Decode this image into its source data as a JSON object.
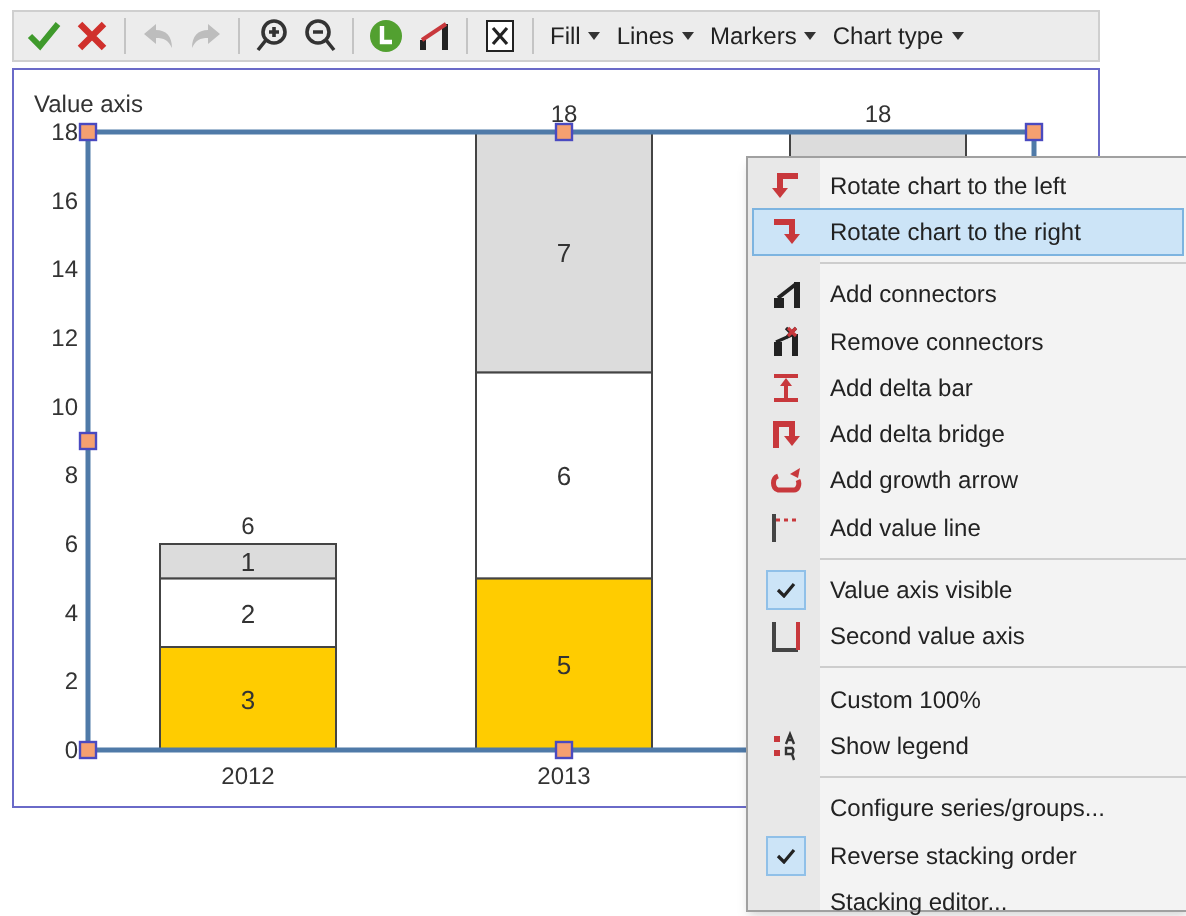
{
  "toolbar": {
    "buttons": [
      {
        "kind": "check",
        "disabled": false
      },
      {
        "kind": "cross",
        "disabled": false
      },
      {
        "kind": "undo",
        "disabled": true
      },
      {
        "kind": "redo",
        "disabled": true
      },
      {
        "kind": "zoom-in",
        "disabled": false
      },
      {
        "kind": "zoom-out",
        "disabled": false
      },
      {
        "kind": "circle-l",
        "disabled": false
      },
      {
        "kind": "chart-line",
        "disabled": false
      },
      {
        "kind": "excel",
        "disabled": false
      }
    ],
    "dropdowns": [
      "Fill",
      "Lines",
      "Markers",
      "Chart type"
    ]
  },
  "chart": {
    "axis_title": "Value axis",
    "totals": [
      "6",
      "18",
      "18"
    ],
    "chart_data": {
      "type": "bar",
      "stacked": true,
      "categories": [
        "2012",
        "2013"
      ],
      "ylim": [
        0,
        18
      ],
      "yticks": [
        0,
        2,
        4,
        6,
        8,
        10,
        12,
        14,
        16,
        18
      ],
      "data_labels": true,
      "series": [
        {
          "color": "#ffcc00",
          "values": [
            3,
            5
          ]
        },
        {
          "color": "#ffffff",
          "values": [
            2,
            6
          ]
        },
        {
          "color": "#dcdcdc",
          "values": [
            1,
            7
          ]
        }
      ]
    }
  },
  "context_menu": {
    "items": [
      {
        "kind": "rotate-left",
        "label": "Rotate chart to the left",
        "selected": false,
        "checked": false
      },
      {
        "kind": "rotate-right",
        "label": "Rotate chart to the right",
        "selected": true,
        "checked": false
      },
      {
        "kind": "separator"
      },
      {
        "kind": "connectors",
        "label": "Add connectors",
        "selected": false,
        "checked": false
      },
      {
        "kind": "remove-connectors",
        "label": "Remove connectors",
        "selected": false,
        "checked": false
      },
      {
        "kind": "delta-bar",
        "label": "Add delta bar",
        "selected": false,
        "checked": false
      },
      {
        "kind": "delta-bridge",
        "label": "Add delta bridge",
        "selected": false,
        "checked": false
      },
      {
        "kind": "growth-arrow",
        "label": "Add growth arrow",
        "selected": false,
        "checked": false
      },
      {
        "kind": "value-line",
        "label": "Add value line",
        "selected": false,
        "checked": false
      },
      {
        "kind": "separator"
      },
      {
        "kind": "plain",
        "label": "Value axis visible",
        "selected": false,
        "checked": true
      },
      {
        "kind": "second-axis",
        "label": "Second value axis",
        "selected": false,
        "checked": false
      },
      {
        "kind": "separator"
      },
      {
        "kind": "plain",
        "label": "Custom 100%",
        "selected": false,
        "checked": false
      },
      {
        "kind": "legend",
        "label": "Show legend",
        "selected": false,
        "checked": false
      },
      {
        "kind": "separator"
      },
      {
        "kind": "plain",
        "label": "Configure series/groups...",
        "selected": false,
        "checked": false
      },
      {
        "kind": "plain",
        "label": "Reverse stacking order",
        "selected": false,
        "checked": true
      },
      {
        "kind": "plain",
        "label": "Stacking editor...",
        "selected": false,
        "checked": false
      }
    ]
  }
}
